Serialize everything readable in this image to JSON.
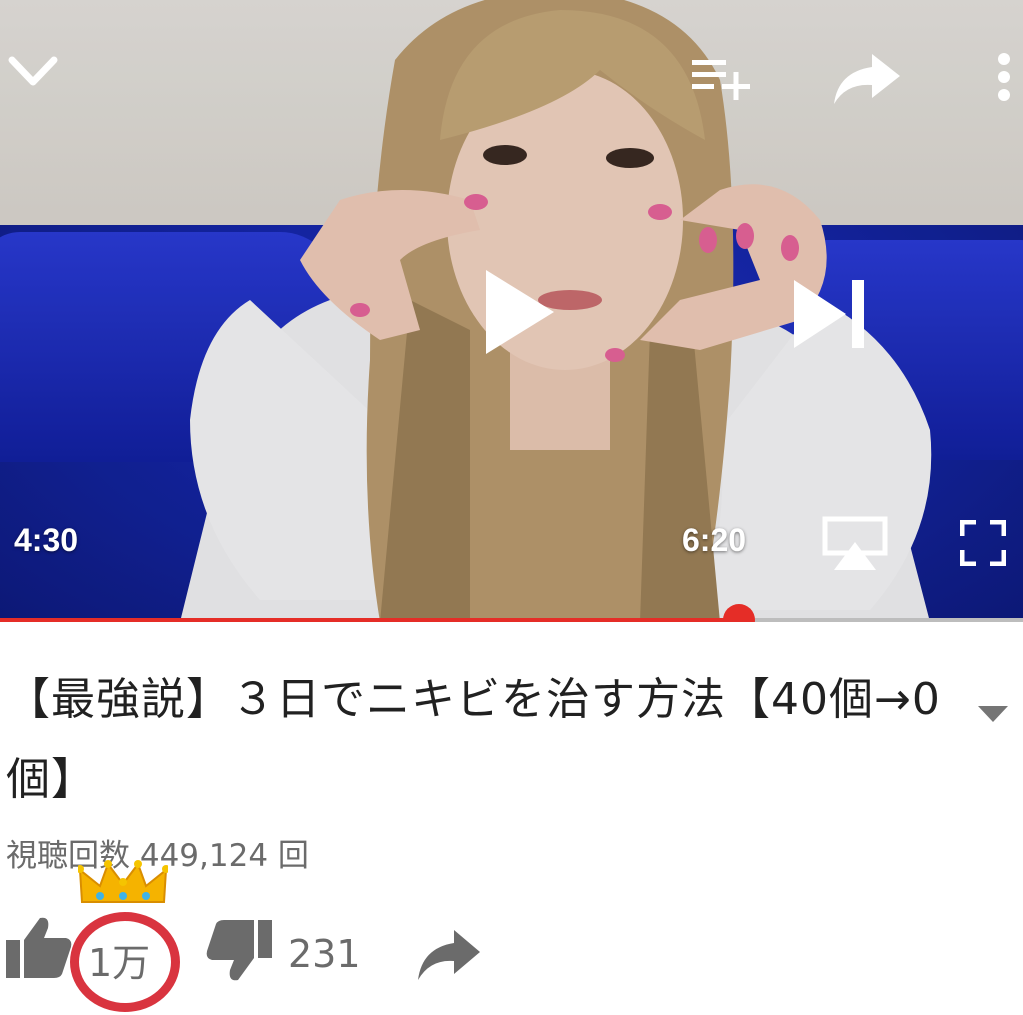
{
  "player": {
    "current_time": "4:30",
    "duration": "6:20",
    "progress_fraction": 0.722,
    "progress_color": "#e52d27"
  },
  "video": {
    "title": "【最強説】３日でニキビを治す方法【40個→0個】",
    "views": "視聴回数 449,124 回"
  },
  "actions": {
    "like_count": "1万",
    "dislike_count": "231"
  },
  "icons": {
    "top_left": "chevron-down-icon",
    "top_right": [
      "add-to-playlist-icon",
      "share-icon",
      "more-vert-icon"
    ],
    "center": [
      "play-icon",
      "skip-next-icon"
    ],
    "bottom_right": [
      "cast-icon",
      "fullscreen-icon"
    ],
    "actions": [
      "thumbs-up-icon",
      "thumbs-down-icon",
      "share-icon"
    ],
    "decoration": "crown-icon"
  },
  "colors": {
    "highlight_circle": "#d9343f",
    "text_secondary": "#6b6b6b"
  }
}
